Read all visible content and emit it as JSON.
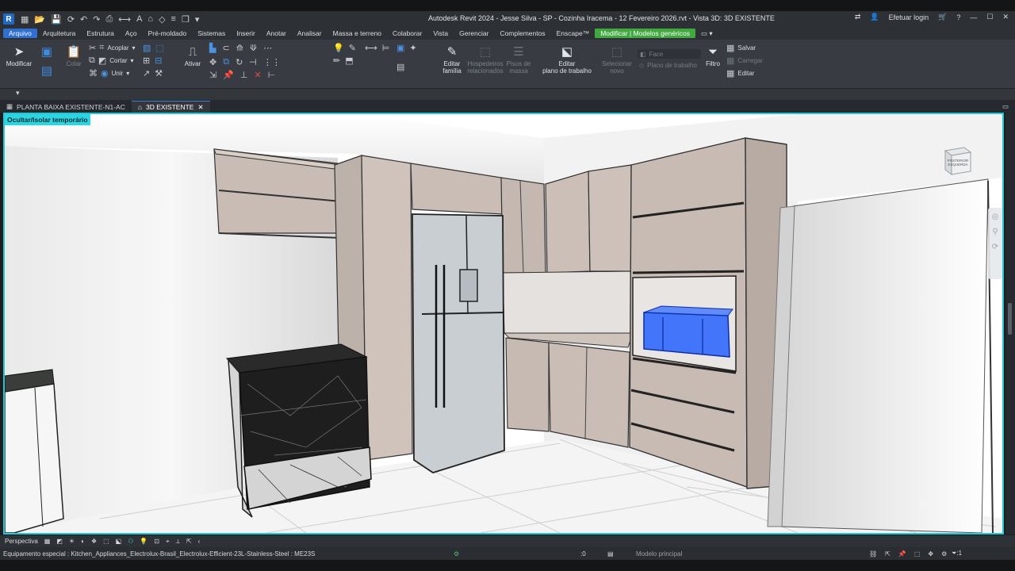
{
  "app": {
    "logo_letter": "R",
    "window_title": "Autodesk Revit 2024 - Jesse Silva - SP - Cozinha Iracema - 12 Fevereiro 2026.rvt - Vista 3D: 3D EXISTENTE",
    "login_label": "Efetuar login"
  },
  "menu": {
    "items": [
      "Arquivo",
      "Arquitetura",
      "Estrutura",
      "Aço",
      "Pré-moldado",
      "Sistemas",
      "Inserir",
      "Anotar",
      "Analisar",
      "Massa e terreno",
      "Colaborar",
      "Vista",
      "Gerenciar",
      "Complementos",
      "Enscape™"
    ],
    "context_tab": "Modificar | Modelos genéricos"
  },
  "ribbon": {
    "modify": "Modificar",
    "paste": "Colar",
    "couple": "Acoplar",
    "cut": "Cortar",
    "join": "Unir",
    "activate": "Ativar",
    "edit_family_1": "Editar",
    "edit_family_2": "família",
    "hosted_1": "Hospedeiros",
    "hosted_2": "relacionados",
    "mass_floors_1": "Pisos de",
    "mass_floors_2": "massa",
    "edit_workplane_1": "Editar",
    "edit_workplane_2": "plano de trabalho",
    "select_new_1": "Selecionar",
    "select_new_2": "novo",
    "face": "Face",
    "workplane": "Plano de trabalho",
    "filter": "Filtro",
    "save": "Salvar",
    "load": "Carregar",
    "edit": "Editar"
  },
  "tabs": [
    {
      "label": "PLANTA BAIXA EXISTENTE-N1-AC",
      "active": false
    },
    {
      "label": "3D EXISTENTE",
      "active": true
    }
  ],
  "viewport": {
    "temp_hide_label": "Ocultar/Isolar temporário",
    "viewcube_label": "POSTERIOR ESQUERDA"
  },
  "view_control": {
    "projection": "Perspectiva"
  },
  "status": {
    "selection_text": "Equipamento especial : Kitchen_Appliances_Electrolux-Brasil_Electrolux-Efficient-23L-Stainless-Steel : ME23S",
    "worksets_count": ":0",
    "model_name": "Modelo principal",
    "filter_count": ":1"
  },
  "colors": {
    "accent": "#2e6fd0",
    "context_tab": "#40a83f",
    "viewport_border": "#27c7d6",
    "selection": "#1f5bff",
    "cabinet": "#cbbfb8"
  }
}
